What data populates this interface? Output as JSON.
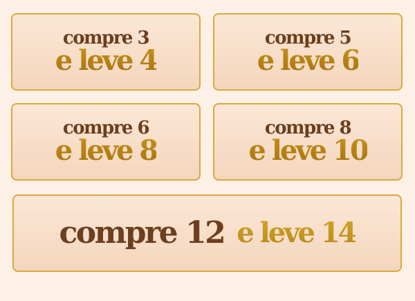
{
  "offers": [
    {
      "buy": "compre 3",
      "get": "e leve 4"
    },
    {
      "buy": "compre 5",
      "get": "e leve 6"
    },
    {
      "buy": "compre 6",
      "get": "e leve 8"
    },
    {
      "buy": "compre 8",
      "get": "e leve 10"
    },
    {
      "buy": "compre 12",
      "get": "e leve 14"
    }
  ],
  "colors": {
    "background": "#fdf0e6",
    "card_border": "#d9a93a",
    "buy_text": "#6b3f1f",
    "get_text": "#b8860b"
  }
}
